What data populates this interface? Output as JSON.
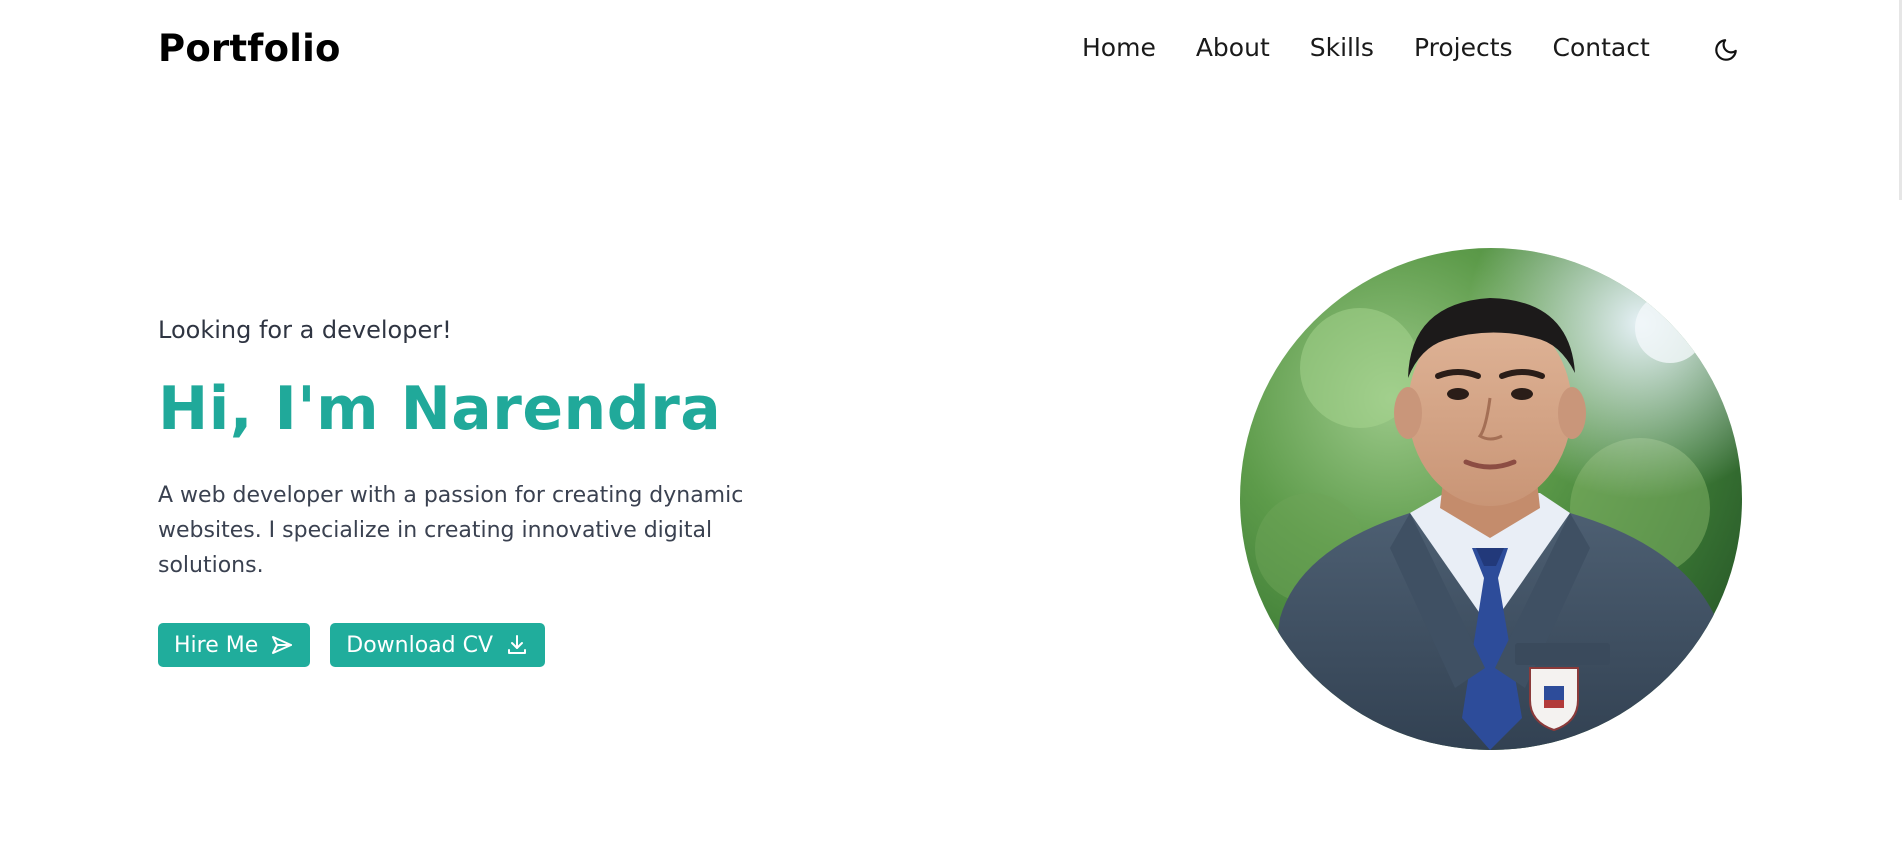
{
  "header": {
    "brand": "Portfolio",
    "nav": [
      "Home",
      "About",
      "Skills",
      "Projects",
      "Contact"
    ],
    "theme_icon": "moon-icon"
  },
  "hero": {
    "tagline": "Looking for a developer!",
    "title": "Hi, I'm Narendra",
    "description": "A web developer with a passion for creating dynamic websites. I specialize in creating innovative digital solutions.",
    "buttons": {
      "hire": {
        "label": "Hire Me",
        "icon": "send-icon"
      },
      "cv": {
        "label": "Download CV",
        "icon": "download-icon"
      }
    }
  },
  "colors": {
    "accent": "#20a99a",
    "text_dark": "#000000",
    "text_body": "#3a4150"
  },
  "avatar": {
    "subject": "portrait-photo"
  }
}
